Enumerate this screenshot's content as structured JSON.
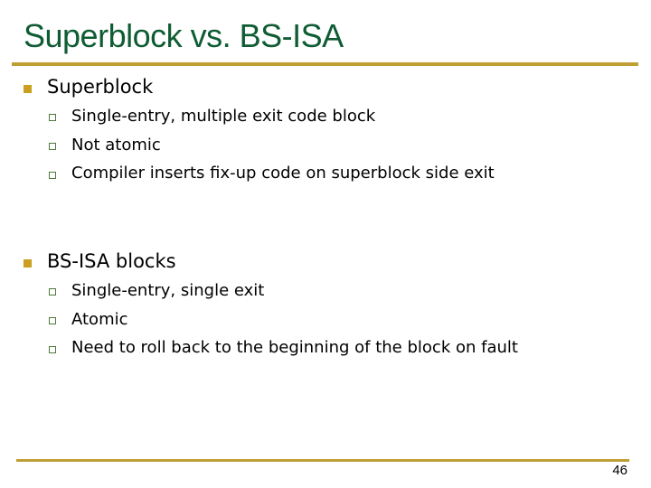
{
  "slide": {
    "title": "Superblock vs. BS-ISA",
    "page_number": "46",
    "accent_color": "#bf9e35",
    "title_color": "#0f5c33",
    "sections": [
      {
        "heading": "Superblock",
        "items": [
          "Single-entry, multiple exit code block",
          "Not atomic",
          "Compiler inserts fix-up code on superblock side exit"
        ]
      },
      {
        "heading": "BS-ISA blocks",
        "items": [
          "Single-entry, single exit",
          "Atomic",
          "Need to roll back to the beginning of the block on fault"
        ]
      }
    ]
  }
}
